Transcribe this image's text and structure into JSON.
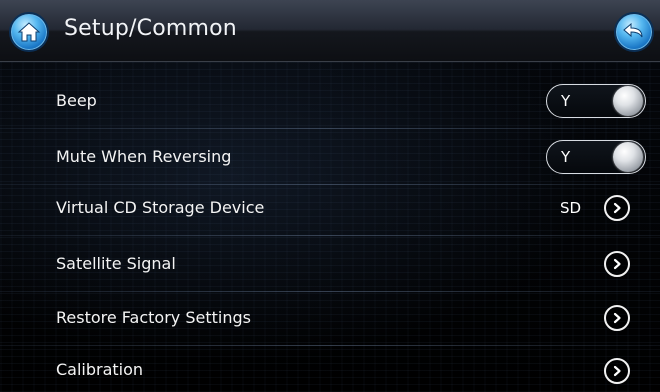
{
  "header": {
    "title": "Setup/Common",
    "home_icon": "home-icon",
    "back_icon": "back-arrow-icon",
    "accent_color": "#2a8fdf"
  },
  "settings": [
    {
      "label": "Beep",
      "control": "toggle",
      "value": "Y",
      "icon": "toggle-knob"
    },
    {
      "label": "Mute When Reversing",
      "control": "toggle",
      "value": "Y",
      "icon": "toggle-knob"
    },
    {
      "label": "Virtual CD Storage Device",
      "control": "select",
      "value": "SD",
      "icon": "chevron-right-icon"
    },
    {
      "label": "Satellite Signal",
      "control": "link",
      "value": "",
      "icon": "chevron-right-icon"
    },
    {
      "label": "Restore Factory Settings",
      "control": "link",
      "value": "",
      "icon": "chevron-right-icon"
    },
    {
      "label": "Calibration",
      "control": "link",
      "value": "",
      "icon": "chevron-right-icon"
    }
  ]
}
